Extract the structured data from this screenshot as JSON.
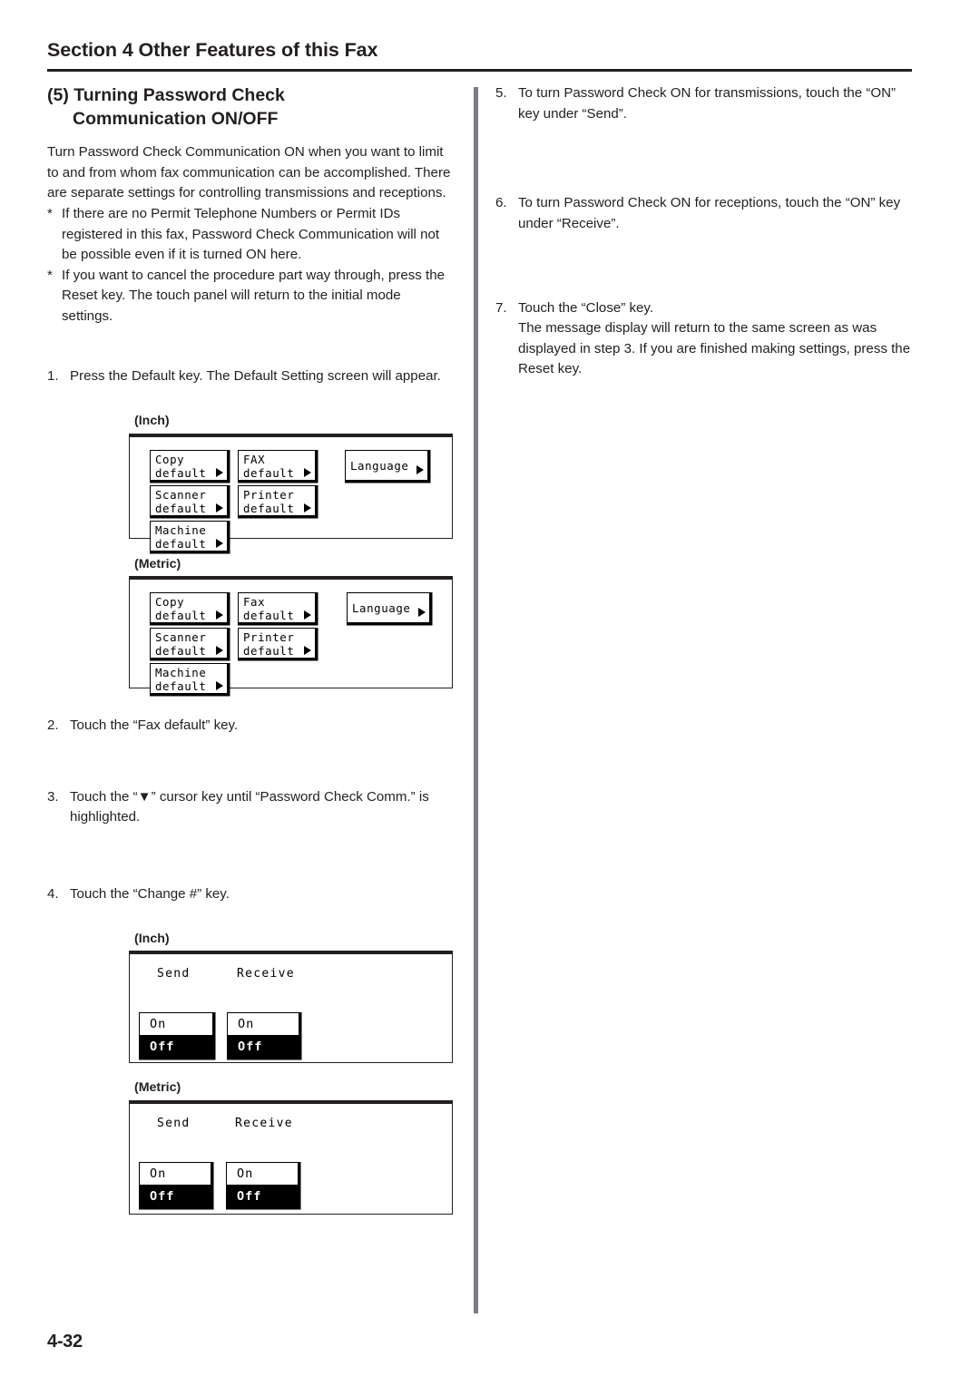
{
  "header": {
    "section_title": "Section 4 Other Features of this Fax"
  },
  "article": {
    "title_line1": "(5) Turning Password Check",
    "title_line2": "Communication ON/OFF",
    "intro": "Turn Password Check Communication ON when you want to limit to and from whom fax communication can be accomplished. There are separate settings for controlling transmissions and receptions.",
    "notes": [
      {
        "marker": "*",
        "text": "If there are no Permit Telephone Numbers or Permit IDs registered in this fax, Password Check Communication will not be possible even if it is turned ON here."
      },
      {
        "marker": "*",
        "text": "If you want to cancel the procedure part way through, press the Reset key. The touch panel will return to the initial mode settings."
      }
    ]
  },
  "steps": {
    "step1": {
      "num": "1.",
      "text": "Press the Default key. The Default Setting screen will appear."
    },
    "step2": {
      "num": "2.",
      "text": "Touch the “Fax default” key."
    },
    "step3": {
      "num": "3.",
      "text": "Touch the “▼” cursor key until “Password Check Comm.” is highlighted."
    },
    "step4": {
      "num": "4.",
      "text": "Touch the “Change #” key."
    },
    "step5": {
      "num": "5.",
      "text": "To turn Password Check ON for transmissions, touch the “ON” key under “Send”."
    },
    "step6": {
      "num": "6.",
      "text": "To turn Password Check ON for receptions, touch the “ON” key under “Receive”."
    },
    "step7": {
      "num": "7.",
      "text": "Touch the “Close” key.",
      "text2": "The message display will return to the same screen as was displayed in step 3. If you are finished making settings, press the Reset key."
    }
  },
  "figures": {
    "default_inch": {
      "unit_label": "(Inch)",
      "keys": [
        {
          "line1": "Copy",
          "line2": "default",
          "arrow": "right-arrow-icon"
        },
        {
          "line1": "FAX",
          "line2": "default",
          "arrow": "right-arrow-icon"
        },
        {
          "line1": "Language",
          "line2": "",
          "arrow": "right-arrow-icon"
        },
        {
          "line1": "Scanner",
          "line2": "default",
          "arrow": "right-arrow-icon"
        },
        {
          "line1": "Printer",
          "line2": "default",
          "arrow": "right-arrow-icon"
        },
        {
          "line1": "Machine",
          "line2": "default",
          "arrow": "right-arrow-icon"
        }
      ]
    },
    "default_metric": {
      "unit_label": "(Metric)",
      "keys": [
        {
          "line1": "Copy",
          "line2": "default",
          "arrow": "right-arrow-icon"
        },
        {
          "line1": "Fax",
          "line2": "default",
          "arrow": "right-arrow-icon"
        },
        {
          "line1": "Language",
          "line2": "",
          "arrow": "right-arrow-icon"
        },
        {
          "line1": "Scanner",
          "line2": "default",
          "arrow": "right-arrow-icon"
        },
        {
          "line1": "Printer",
          "line2": "default",
          "arrow": "right-arrow-icon"
        },
        {
          "line1": "Machine",
          "line2": "default",
          "arrow": "right-arrow-icon"
        }
      ]
    },
    "onoff_inch": {
      "unit_label": "(Inch)",
      "col_send": "Send",
      "col_receive": "Receive",
      "send": {
        "on": "On",
        "off": "Off",
        "selected": "Off"
      },
      "receive": {
        "on": "On",
        "off": "Off",
        "selected": "Off"
      }
    },
    "onoff_metric": {
      "unit_label": "(Metric)",
      "col_send": "Send",
      "col_receive": "Receive",
      "send": {
        "on": "On",
        "off": "Off",
        "selected": "Off"
      },
      "receive": {
        "on": "On",
        "off": "Off",
        "selected": "Off"
      }
    }
  },
  "footer": {
    "page_number": "4-32"
  }
}
